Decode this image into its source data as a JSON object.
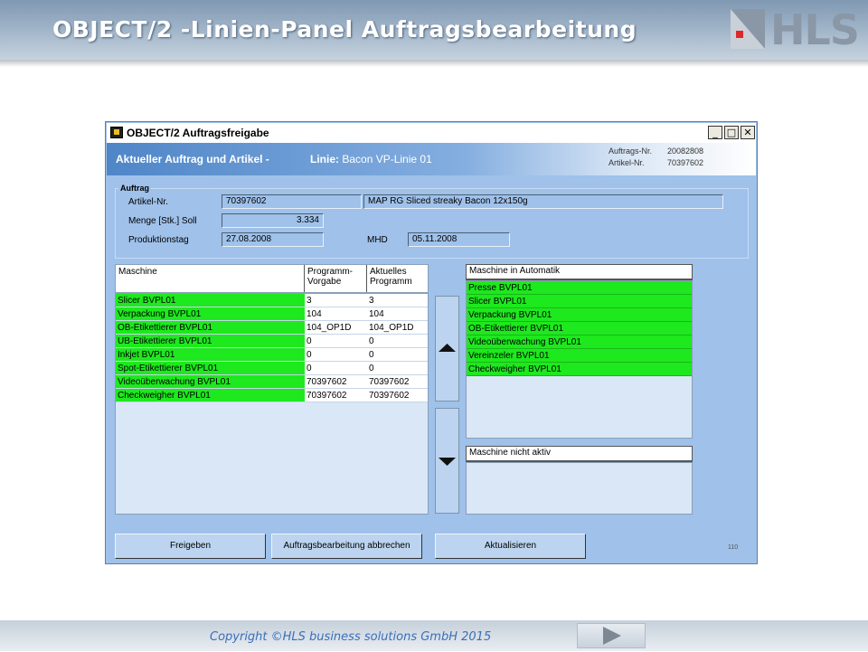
{
  "slide": {
    "title": "OBJECT/2 -Linien-Panel Auftragsbearbeitung",
    "logo_text": "HLS",
    "copyright": "Copyright ©HLS business solutions GmbH 2015"
  },
  "window": {
    "title": "OBJECT/2 Auftragsfreigabe",
    "controls": {
      "minimize": "_",
      "maximize": "□",
      "close": "✕"
    },
    "header": {
      "label": "Aktueller Auftrag und Artikel -",
      "line_label": "Linie:",
      "line_value": "Bacon VP-Linie 01",
      "order_no_label": "Auftrags-Nr.",
      "order_no_value": "20082808",
      "article_no_label": "Artikel-Nr.",
      "article_no_value": "70397602"
    },
    "order": {
      "group_title": "Auftrag",
      "article_label": "Artikel-Nr.",
      "article_value": "70397602",
      "article_desc": "MAP RG Sliced streaky Bacon 12x150g",
      "quantity_label": "Menge [Stk.] Soll",
      "quantity_value": "3.334",
      "production_day_label": "Produktionstag",
      "production_day_value": "27.08.2008",
      "mhd_label": "MHD",
      "mhd_value": "05.11.2008"
    },
    "machines_table": {
      "headers": [
        "Maschine",
        "Programm-\nVorgabe",
        "Aktuelles\nProgramm"
      ],
      "rows": [
        {
          "machine": "Slicer BVPL01",
          "target": "3",
          "current": "3"
        },
        {
          "machine": "Verpackung BVPL01",
          "target": "104",
          "current": "104"
        },
        {
          "machine": "OB-Etikettierer BVPL01",
          "target": "104_OP1D",
          "current": "104_OP1D"
        },
        {
          "machine": "UB-Etikettierer BVPL01",
          "target": "0",
          "current": "0"
        },
        {
          "machine": "Inkjet BVPL01",
          "target": "0",
          "current": "0"
        },
        {
          "machine": "Spot-Etikettierer BVPL01",
          "target": "0",
          "current": "0"
        },
        {
          "machine": "Videoüberwachung BVPL01",
          "target": "70397602",
          "current": "70397602"
        },
        {
          "machine": "Checkweigher BVPL01",
          "target": "70397602",
          "current": "70397602"
        }
      ]
    },
    "automatic_list": {
      "title": "Maschine in Automatik",
      "items": [
        "Presse BVPL01",
        "Slicer BVPL01",
        "Verpackung BVPL01",
        "OB-Etikettierer BVPL01",
        "Videoüberwachung BVPL01",
        "Vereinzeler BVPL01",
        "Checkweigher BVPL01"
      ]
    },
    "inactive_list": {
      "title": "Maschine nicht aktiv",
      "items": []
    },
    "buttons": {
      "release": "Freigeben",
      "cancel": "Auftragsbearbeitung abbrechen",
      "refresh": "Aktualisieren"
    },
    "version": "110",
    "colors": {
      "active_row": "#1ee81e",
      "panel": "#9fc1ea"
    }
  }
}
